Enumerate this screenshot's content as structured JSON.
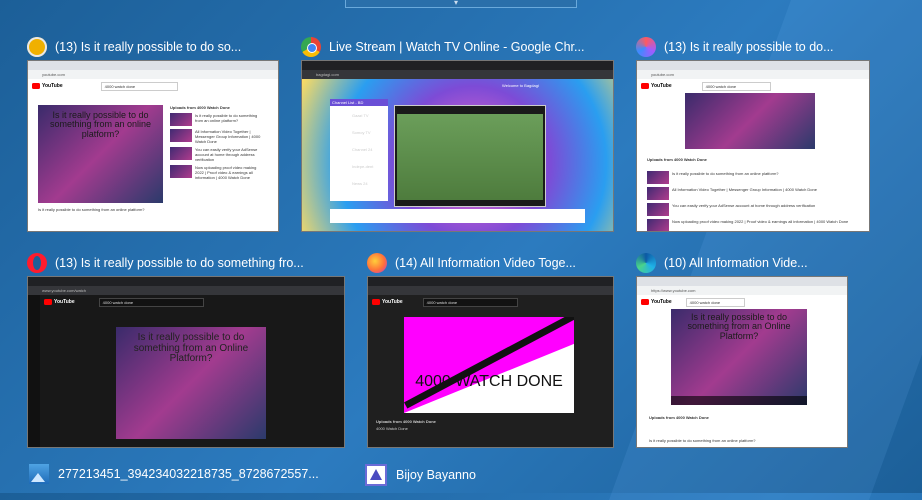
{
  "windows": [
    {
      "title": "(13) Is it really possible to do so...",
      "icon": "brave-browser-icon",
      "url": "youtube.com",
      "search": "4000 watch done",
      "video_title": "Is it really possible to do something from an online platform?",
      "channel": "4000 Watch Done",
      "rail_title": "Uploads from 4000 Watch Done"
    },
    {
      "title": "Live Stream | Watch TV Online - Google Chr...",
      "icon": "chrome-icon",
      "url": "bagdagi.com",
      "site_banner": "Welcome to Bagdagi",
      "sidebar_title": "Channel List - BD",
      "channels": [
        "Gaazi TV",
        "Somoy TV",
        "Channel 24",
        "Indepe-dent",
        "News 24"
      ]
    },
    {
      "title": "(13) Is it really possible to do...",
      "icon": "arc-browser-icon",
      "url": "youtube.com",
      "search": "4000 watch done",
      "rail_title": "Uploads from 4000 Watch Done",
      "items": [
        "Is it really possible to do something from an online platform?",
        "All Information Video Together | Messenger Group Information | 4000 Watch Done",
        "You can easily verify your AdSense account at home through address verification",
        "Now uploading proof video making 2022 | Proof video & earnings all information | 4000 Watch Done"
      ]
    },
    {
      "title": "(13) Is it really possible to do something fro...",
      "icon": "opera-icon",
      "url": "www.youtube.com/watch",
      "search": "4000 watch done",
      "video_title": "Is it really possible to do something from an Online Platform?"
    },
    {
      "title": "(14) All Information Video Toge...",
      "icon": "firefox-icon",
      "search": "4000 watch done",
      "video_title": "4000 WATCH DONE",
      "rail_title": "Uploads from 4000 Watch Done",
      "channel": "4000 Watch Done"
    },
    {
      "title": "(10) All Information Vide...",
      "icon": "edge-icon",
      "url": "https://www.youtube.com",
      "search": "4000 watch done",
      "video_title": "Is it really possible to do something from an Online Platform?",
      "rail_title": "Uploads from 4000 Watch Done",
      "caption": "Is it really possible to do something from an online platform?"
    }
  ],
  "bottom": [
    {
      "label": "277213451_394234032218735_8728672557...",
      "icon": "photos-icon"
    },
    {
      "label": "Bijoy Bayanno",
      "icon": "bijoy-icon"
    }
  ]
}
